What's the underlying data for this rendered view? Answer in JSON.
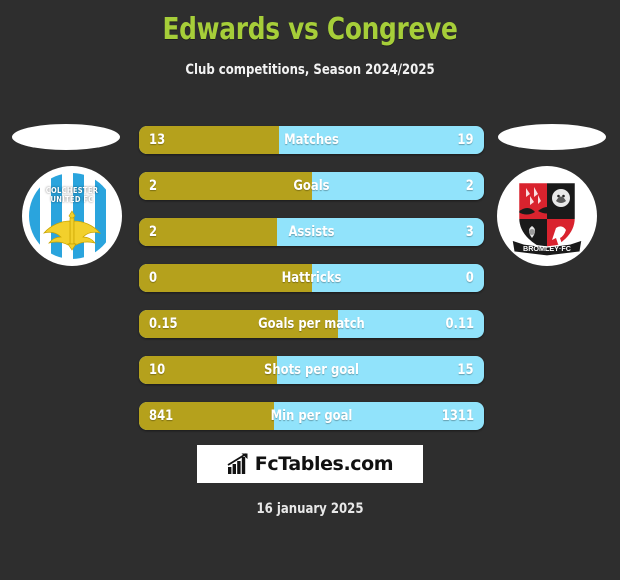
{
  "header": {
    "title": "Edwards vs Congreve",
    "subtitle": "Club competitions, Season 2024/2025",
    "title_color": "#a6ce39"
  },
  "teams": {
    "home": {
      "name": "Colchester United FC",
      "crest_line1": "COLCHESTER",
      "crest_line2": "UNITED FC",
      "colors": {
        "primary": "#2aa4dd",
        "secondary": "#ffffff",
        "accent": "#f2d02c"
      }
    },
    "away": {
      "name": "Bromley FC",
      "crest_banner": "BROMLEY  FC",
      "colors": {
        "primary": "#d9232e",
        "secondary": "#1a1a1a",
        "accent": "#ffffff"
      }
    }
  },
  "chart_data": {
    "type": "bar",
    "title": "Edwards vs Congreve",
    "subtitle": "Club competitions, Season 2024/2025",
    "orientation": "horizontal-diverging",
    "legend": [
      "Edwards",
      "Congreve"
    ],
    "colors": {
      "left": "#b5a11c",
      "right": "#91e3fb",
      "background": "#2e2e2e"
    },
    "categories": [
      "Matches",
      "Goals",
      "Assists",
      "Hattricks",
      "Goals per match",
      "Shots per goal",
      "Min per goal"
    ],
    "series": [
      {
        "name": "Edwards",
        "values": [
          13,
          2,
          2,
          0,
          0.15,
          10,
          841
        ]
      },
      {
        "name": "Congreve",
        "values": [
          19,
          2,
          3,
          0,
          0.11,
          15,
          1311
        ]
      }
    ],
    "left_fill_percent": [
      40.6,
      50,
      40,
      50,
      57.7,
      40,
      39.1
    ]
  },
  "stats": [
    {
      "label": "Matches",
      "left": "13",
      "right": "19",
      "fill": 40.6
    },
    {
      "label": "Goals",
      "left": "2",
      "right": "2",
      "fill": 50
    },
    {
      "label": "Assists",
      "left": "2",
      "right": "3",
      "fill": 40
    },
    {
      "label": "Hattricks",
      "left": "0",
      "right": "0",
      "fill": 50
    },
    {
      "label": "Goals per match",
      "left": "0.15",
      "right": "0.11",
      "fill": 57.7
    },
    {
      "label": "Shots per goal",
      "left": "10",
      "right": "15",
      "fill": 40
    },
    {
      "label": "Min per goal",
      "left": "841",
      "right": "1311",
      "fill": 39.1
    }
  ],
  "footer": {
    "logo_text": "FcTables.com",
    "logo_icon": "bar-chart-arrow-icon",
    "date": "16 january 2025"
  }
}
